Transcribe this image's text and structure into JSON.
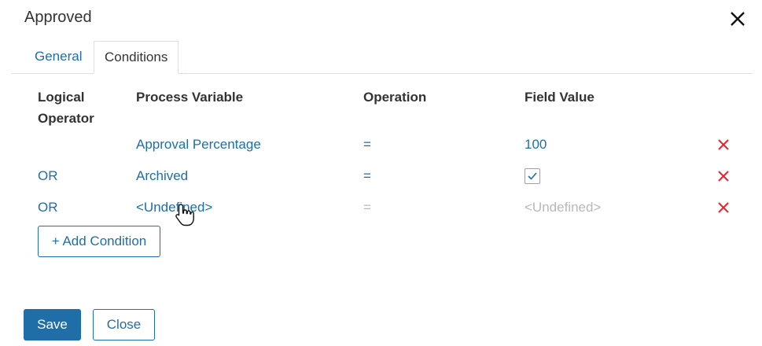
{
  "dialog": {
    "title": "Approved",
    "close_icon": "close-icon"
  },
  "tabs": [
    {
      "label": "General",
      "active": false
    },
    {
      "label": "Conditions",
      "active": true
    }
  ],
  "table": {
    "headers": {
      "logical_operator_line1": "Logical",
      "logical_operator_line2": "Operator",
      "process_variable": "Process Variable",
      "operation": "Operation",
      "field_value": "Field Value"
    },
    "rows": [
      {
        "logical_operator": "",
        "process_variable": "Approval Percentage",
        "operation": "=",
        "field_value": "100"
      },
      {
        "logical_operator": "OR",
        "process_variable": "Archived",
        "operation": "=",
        "field_value_checkbox": true
      },
      {
        "logical_operator": "OR",
        "process_variable": "<Undefined>",
        "operation": "=",
        "field_value": "<Undefined>"
      }
    ]
  },
  "buttons": {
    "add_condition": "+ Add Condition",
    "save": "Save",
    "cancel": "Close"
  },
  "colors": {
    "accent": "#1f6ea8",
    "delete": "#e0282e",
    "muted": "#b8b8b8"
  }
}
